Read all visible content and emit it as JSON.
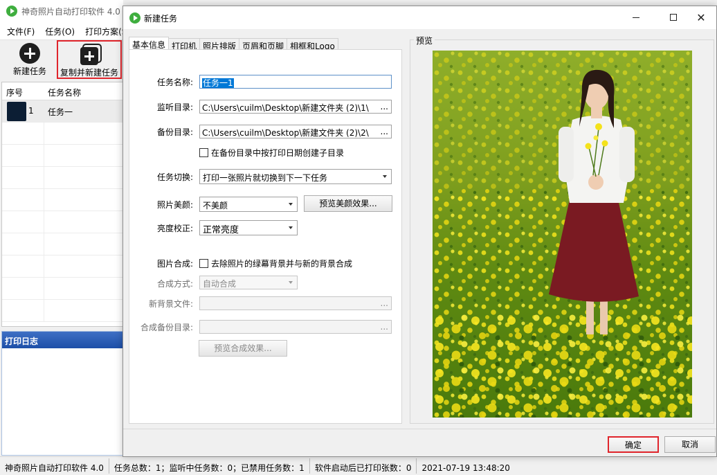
{
  "app": {
    "title": "神奇照片自动打印软件 4.0",
    "menu": [
      "文件(F)",
      "任务(O)",
      "打印方案(S)"
    ],
    "toolbar": {
      "new_task": "新建任务",
      "copy_new_task": "复制并新建任务"
    },
    "task_table": {
      "headers": [
        "序号",
        "任务名称"
      ],
      "rows": [
        {
          "index": "1",
          "name": "任务一"
        }
      ]
    },
    "log_title": "打印日志",
    "statusbar": [
      "神奇照片自动打印软件 4.0",
      "任务总数：1；监听中任务数：0；已禁用任务数：1",
      "软件启动后已打印张数：0",
      "2021-07-19 13:48:20"
    ]
  },
  "dialog": {
    "title": "新建任务",
    "tabs": [
      "基本信息",
      "打印机",
      "照片排版",
      "页眉和页脚",
      "相框和Logo"
    ],
    "active_tab": "基本信息",
    "form": {
      "task_name_label": "任务名称:",
      "task_name_value": "任务一1",
      "watch_dir_label": "监听目录:",
      "watch_dir_value": "C:\\Users\\cuilm\\Desktop\\新建文件夹 (2)\\1\\",
      "backup_dir_label": "备份目录:",
      "backup_dir_value": "C:\\Users\\cuilm\\Desktop\\新建文件夹 (2)\\2\\",
      "browse": "...",
      "date_subdir_checkbox": "在备份目录中按打印日期创建子目录",
      "task_switch_label": "任务切换:",
      "task_switch_value": "打印一张照片就切换到下一下任务",
      "beauty_label": "照片美颜:",
      "beauty_value": "不美颜",
      "preview_beauty_button": "预览美颜效果...",
      "brightness_label": "亮度校正:",
      "brightness_value": "正常亮度",
      "compose_label": "图片合成:",
      "compose_checkbox": "去除照片的绿幕背景并与新的背景合成",
      "compose_mode_label": "合成方式:",
      "compose_mode_value": "自动合成",
      "new_bg_label": "新背景文件:",
      "compose_backup_label": "合成备份目录:",
      "preview_compose_button": "预览合成效果..."
    },
    "preview_title": "预览",
    "ok": "确定",
    "cancel": "取消"
  },
  "colors": {
    "highlight_border": "#e0242b",
    "selection": "#0078d7",
    "log_header": "#1d4fa8"
  }
}
